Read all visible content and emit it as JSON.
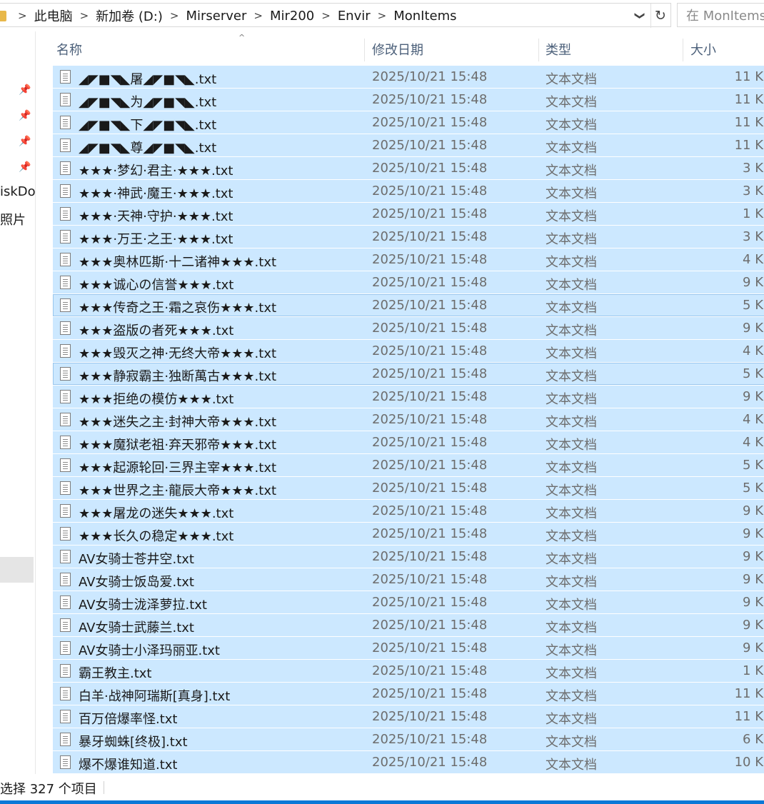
{
  "address": {
    "crumbs": [
      "此电脑",
      "新加卷 (D:)",
      "Mirserver",
      "Mir200",
      "Envir",
      "MonItems"
    ],
    "separator": ">",
    "dropdown_glyph": "❯",
    "refresh_glyph": "↻",
    "search_placeholder": "在 MonItems 中搜索"
  },
  "nav": {
    "items": [
      {
        "icon": "pin-icon"
      },
      {
        "icon": "pin-icon"
      },
      {
        "icon": "pin-icon"
      },
      {
        "icon": "pin-icon"
      }
    ],
    "labels": [
      "iskDo",
      "照片"
    ]
  },
  "columns": {
    "name": "名称",
    "date": "修改日期",
    "type": "类型",
    "size": "大小",
    "sort_glyph": "^"
  },
  "files": [
    {
      "name": "◢◤■◥◣屠◢◤■◥◣.txt",
      "date": "2025/10/21 15:48",
      "type": "文本文档",
      "size": "11 K"
    },
    {
      "name": "◢◤■◥◣为◢◤■◥◣.txt",
      "date": "2025/10/21 15:48",
      "type": "文本文档",
      "size": "11 K"
    },
    {
      "name": "◢◤■◥◣下◢◤■◥◣.txt",
      "date": "2025/10/21 15:48",
      "type": "文本文档",
      "size": "11 K"
    },
    {
      "name": "◢◤■◥◣尊◢◤■◥◣.txt",
      "date": "2025/10/21 15:48",
      "type": "文本文档",
      "size": "11 K"
    },
    {
      "name": "★★★·梦幻·君主·★★★.txt",
      "date": "2025/10/21 15:48",
      "type": "文本文档",
      "size": "3 K"
    },
    {
      "name": "★★★·神武·魔王·★★★.txt",
      "date": "2025/10/21 15:48",
      "type": "文本文档",
      "size": "3 K"
    },
    {
      "name": "★★★·天神·守护·★★★.txt",
      "date": "2025/10/21 15:48",
      "type": "文本文档",
      "size": "1 K"
    },
    {
      "name": "★★★·万王·之王·★★★.txt",
      "date": "2025/10/21 15:48",
      "type": "文本文档",
      "size": "3 K"
    },
    {
      "name": "★★★奥林匹斯·十二诸神★★★.txt",
      "date": "2025/10/21 15:48",
      "type": "文本文档",
      "size": "4 K"
    },
    {
      "name": "★★★诚心の信誉★★★.txt",
      "date": "2025/10/21 15:48",
      "type": "文本文档",
      "size": "9 K"
    },
    {
      "name": "★★★传奇之王·霜之哀伤★★★.txt",
      "date": "2025/10/21 15:48",
      "type": "文本文档",
      "size": "5 K"
    },
    {
      "name": "★★★盗版の者死★★★.txt",
      "date": "2025/10/21 15:48",
      "type": "文本文档",
      "size": "9 K"
    },
    {
      "name": "★★★毁灭之神·无终大帝★★★.txt",
      "date": "2025/10/21 15:48",
      "type": "文本文档",
      "size": "4 K"
    },
    {
      "name": "★★★静寂霸主·独断萬古★★★.txt",
      "date": "2025/10/21 15:48",
      "type": "文本文档",
      "size": "5 K"
    },
    {
      "name": "★★★拒绝の模仿★★★.txt",
      "date": "2025/10/21 15:48",
      "type": "文本文档",
      "size": "9 K"
    },
    {
      "name": "★★★迷失之主·封神大帝★★★.txt",
      "date": "2025/10/21 15:48",
      "type": "文本文档",
      "size": "4 K"
    },
    {
      "name": "★★★魔狱老祖·弃天邪帝★★★.txt",
      "date": "2025/10/21 15:48",
      "type": "文本文档",
      "size": "4 K"
    },
    {
      "name": "★★★起源轮回·三界主宰★★★.txt",
      "date": "2025/10/21 15:48",
      "type": "文本文档",
      "size": "5 K"
    },
    {
      "name": "★★★世界之主·龍辰大帝★★★.txt",
      "date": "2025/10/21 15:48",
      "type": "文本文档",
      "size": "5 K"
    },
    {
      "name": "★★★屠龙の迷失★★★.txt",
      "date": "2025/10/21 15:48",
      "type": "文本文档",
      "size": "9 K"
    },
    {
      "name": "★★★长久の稳定★★★.txt",
      "date": "2025/10/21 15:48",
      "type": "文本文档",
      "size": "9 K"
    },
    {
      "name": "AV女骑士苍井空.txt",
      "date": "2025/10/21 15:48",
      "type": "文本文档",
      "size": "9 K"
    },
    {
      "name": "AV女骑士饭岛爱.txt",
      "date": "2025/10/21 15:48",
      "type": "文本文档",
      "size": "9 K"
    },
    {
      "name": "AV女骑士泷泽萝拉.txt",
      "date": "2025/10/21 15:48",
      "type": "文本文档",
      "size": "9 K"
    },
    {
      "name": "AV女骑士武藤兰.txt",
      "date": "2025/10/21 15:48",
      "type": "文本文档",
      "size": "9 K"
    },
    {
      "name": "AV女骑士小泽玛丽亚.txt",
      "date": "2025/10/21 15:48",
      "type": "文本文档",
      "size": "9 K"
    },
    {
      "name": "霸王教主.txt",
      "date": "2025/10/21 15:48",
      "type": "文本文档",
      "size": "1 K"
    },
    {
      "name": "白羊·战神阿瑞斯[真身].txt",
      "date": "2025/10/21 15:48",
      "type": "文本文档",
      "size": "11 K"
    },
    {
      "name": "百万倍爆率怪.txt",
      "date": "2025/10/21 15:48",
      "type": "文本文档",
      "size": "11 K"
    },
    {
      "name": "暴牙蜘蛛[终极].txt",
      "date": "2025/10/21 15:48",
      "type": "文本文档",
      "size": "6 K"
    },
    {
      "name": "爆不爆谁知道.txt",
      "date": "2025/10/21 15:48",
      "type": "文本文档",
      "size": "10 K"
    }
  ],
  "status": {
    "text": "选择 327 个项目"
  },
  "colors": {
    "selection_bg": "#cce8ff",
    "focus_border": "#99c6ee",
    "header_text": "#4c607a",
    "accent": "#0a78d7"
  }
}
